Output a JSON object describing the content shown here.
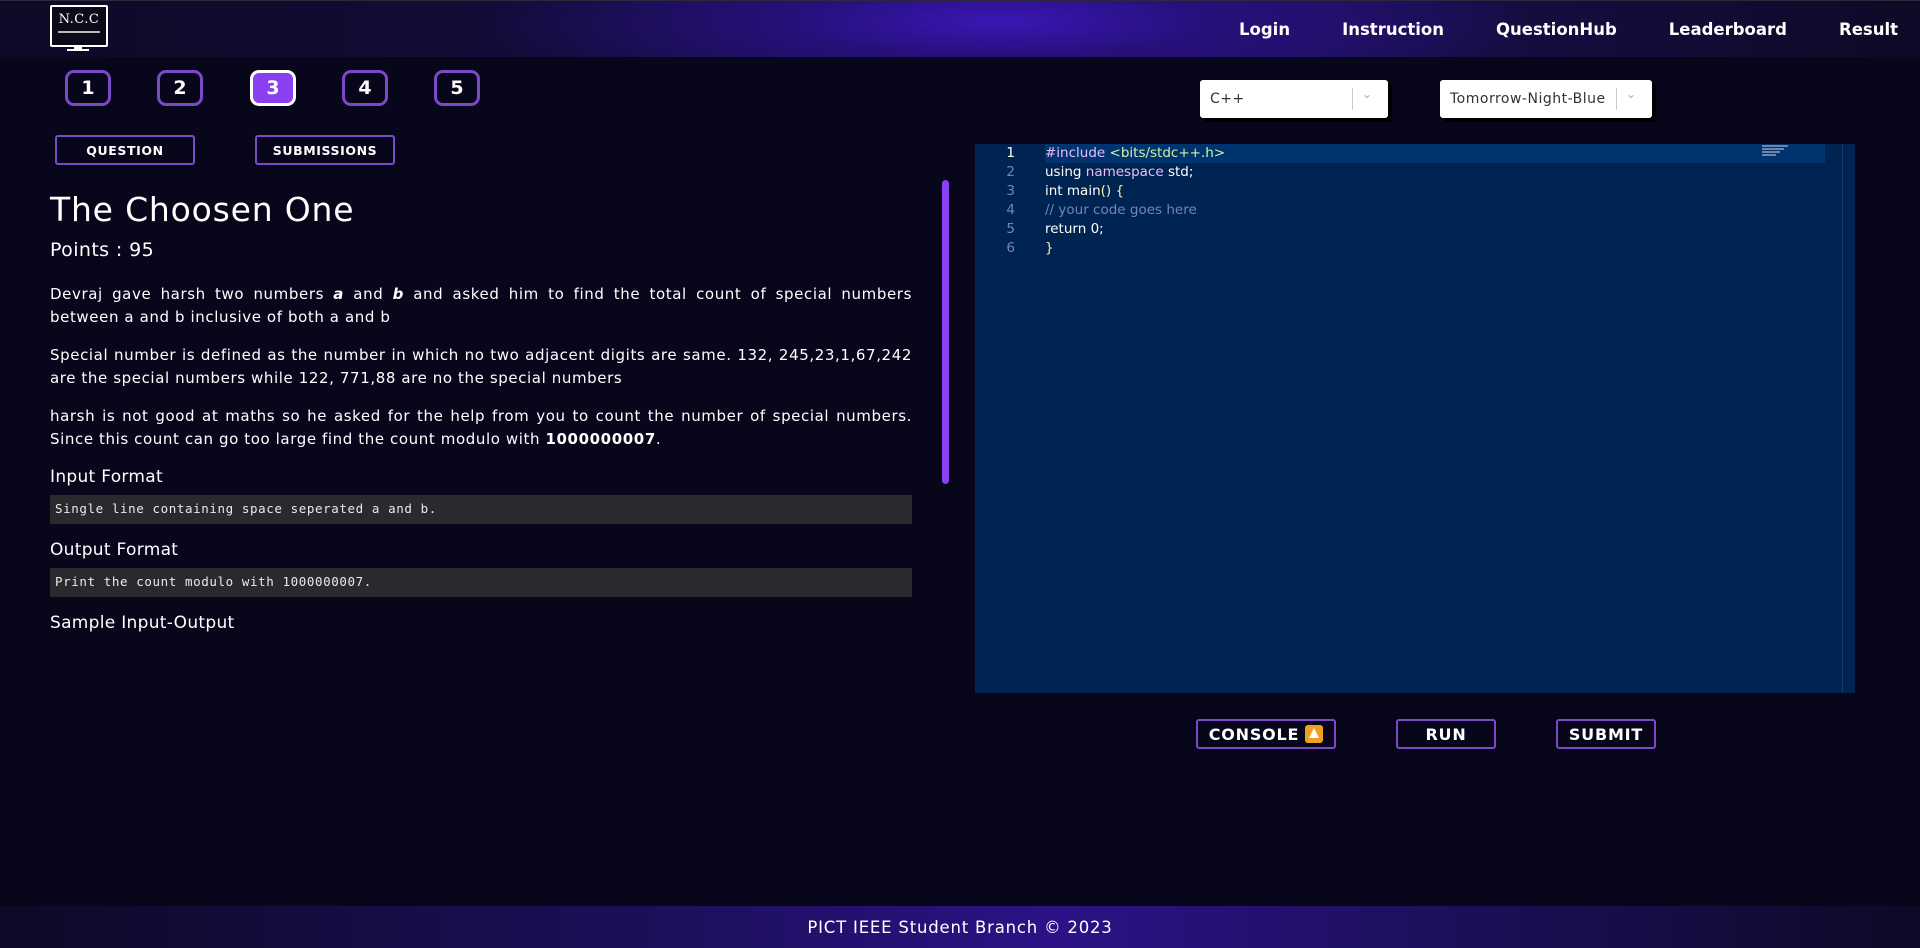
{
  "nav": {
    "logo_text": "N.C.C",
    "links": [
      "Login",
      "Instruction",
      "QuestionHub",
      "Leaderboard",
      "Result"
    ]
  },
  "questions": [
    "1",
    "2",
    "3",
    "4",
    "5"
  ],
  "active_question": "3",
  "tabs": {
    "question": "QUESTION",
    "submissions": "SUBMISSIONS"
  },
  "problem": {
    "title": "The Choosen One",
    "points": "Points : 95",
    "p1": {
      "pre": "Devraj gave harsh two numbers ",
      "a": "a",
      "mid": " and ",
      "b": "b",
      "post": " and asked him to find the total count of special numbers between a and b inclusive of both a and b"
    },
    "p2": "Special number is defined as the number in which no two adjacent digits are same.  132, 245,23,1,67,242 are the special numbers while 122, 771,88 are no the special numbers",
    "p3": {
      "pre": "harsh is not good at maths so he asked for the help from you to count the number of special numbers. Since this count can go too large find the count modulo with ",
      "mod": "1000000007",
      "post": "."
    },
    "input_format_heading": "Input Format",
    "input_format": "Single line containing space seperated a and b.",
    "output_format_heading": "Output Format",
    "output_format": "Print the count modulo with 1000000007.",
    "sample_heading": "Sample Input-Output"
  },
  "editor": {
    "language": "C++",
    "theme": "Tomorrow-Night-Blue",
    "line_numbers": [
      "1",
      "2",
      "3",
      "4",
      "5",
      "6"
    ],
    "lines": {
      "l1_pre": "#include ",
      "l1_inc": "<bits/stdc++.h>",
      "l2_kw": "using ",
      "l2_kw2": "namespace ",
      "l2_id": "std;",
      "l3_kw": "int ",
      "l3_fn": "main",
      "l3_br": "() {",
      "l4_cm": "// your code goes here",
      "l5_kw": "return ",
      "l5_num": "0",
      "l5_end": ";",
      "l6_br": "}"
    },
    "colors": {
      "background": "#002451",
      "active_line": "#00346e"
    }
  },
  "actions": {
    "console": "CONSOLE",
    "run": "RUN",
    "submit": "SUBMIT"
  },
  "footer": "PICT IEEE Student Branch © 2023",
  "colors": {
    "accent": "#8a3ff0",
    "border": "#7b4ac9",
    "bg": "#07061b"
  }
}
